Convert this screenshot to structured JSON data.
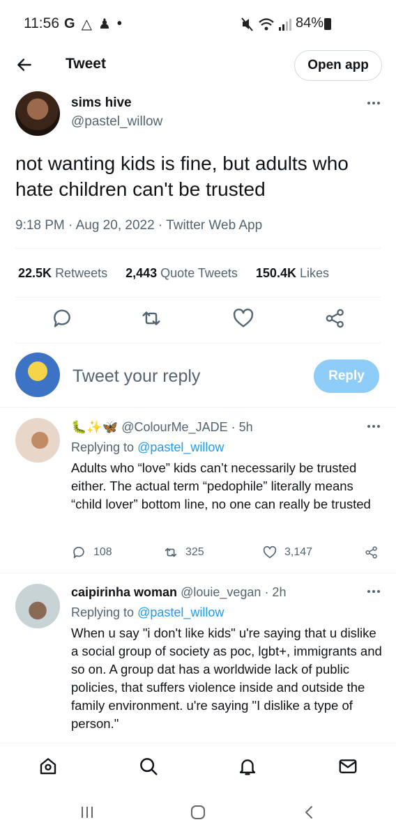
{
  "status_bar": {
    "time": "11:56",
    "left_icons": [
      "G",
      "△",
      "♟",
      "•"
    ],
    "battery": "84%"
  },
  "header": {
    "title": "Tweet",
    "open_app": "Open app"
  },
  "tweet": {
    "display_name": "sims hive",
    "handle": "@pastel_willow",
    "text": "not wanting kids is fine, but adults who hate children can't be trusted",
    "meta": "9:18 PM · Aug 20, 2022 · Twitter Web App",
    "stats": {
      "retweets_count": "22.5K",
      "retweets_label": "Retweets",
      "quotes_count": "2,443",
      "quotes_label": "Quote Tweets",
      "likes_count": "150.4K",
      "likes_label": "Likes"
    }
  },
  "composer": {
    "placeholder": "Tweet your reply",
    "button": "Reply"
  },
  "replies": [
    {
      "emoji": "🐛✨🦋",
      "display_name": "",
      "handle": "@ColourMe_JADE",
      "time": "· 5h",
      "replying_to_label": "Replying to",
      "replying_to_handle": "@pastel_willow",
      "text": "Adults who “love” kids can’t necessarily be trusted either. The actual term “pedophile” literally means “child lover” bottom line, no one can really be trusted",
      "reply_count": "108",
      "retweet_count": "325",
      "like_count": "3,147"
    },
    {
      "display_name": "caipirinha woman",
      "handle": "@louie_vegan",
      "time": "· 2h",
      "replying_to_label": "Replying to",
      "replying_to_handle": "@pastel_willow",
      "text": "When u say \"i don't like kids\" u're saying that u dislike a social group of society as poc, lgbt+, immigrants and so on. A group dat has a worldwide lack of public policies, that suffers violence inside and outside the family environment. u're saying \"I dislike a type of person.\""
    }
  ],
  "icons": {
    "accent": "#1d9bf0",
    "muted": "#536471"
  }
}
